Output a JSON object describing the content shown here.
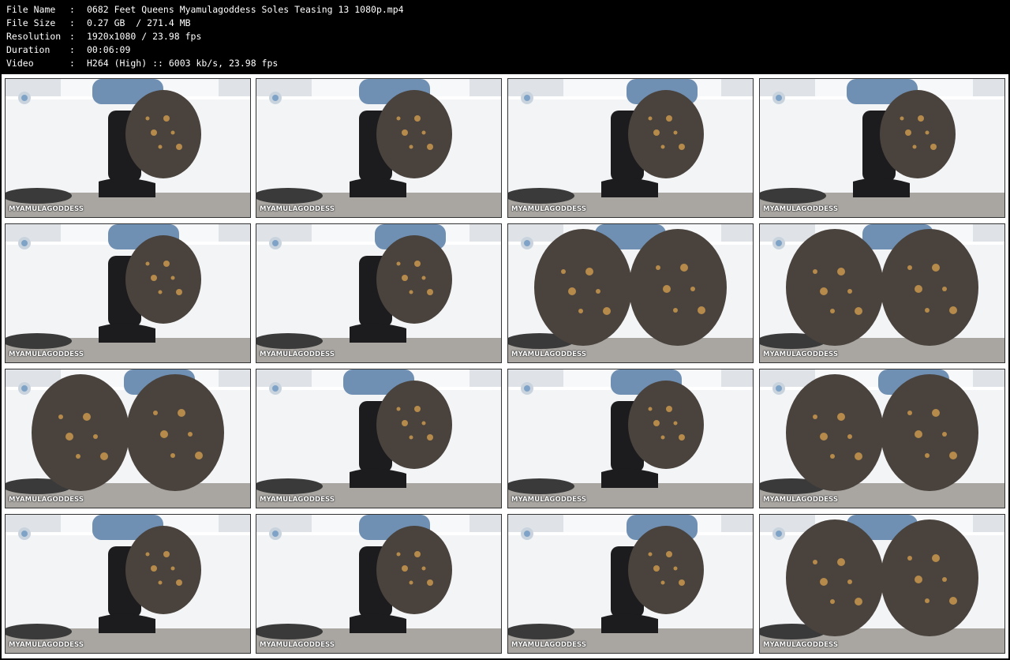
{
  "meta": {
    "rows": [
      {
        "key": "File Name",
        "sep": ":",
        "value": "0682 Feet Queens Myamulagoddess Soles Teasing 13 1080p.mp4"
      },
      {
        "key": "File Size",
        "sep": ":",
        "value": "0.27 GB  / 271.4 MB"
      },
      {
        "key": "Resolution",
        "sep": ":",
        "value": "1920x1080 / 23.98 fps"
      },
      {
        "key": "Duration",
        "sep": ":",
        "value": "00:06:09"
      },
      {
        "key": "Video",
        "sep": ":",
        "value": "H264 (High) :: 6003 kb/s, 23.98 fps"
      }
    ]
  },
  "thumbnails": {
    "watermark": "MYAMULAGODDESS",
    "count": 16,
    "colors": {
      "tub": "#f2f4f6",
      "wall": "#dfe3e8",
      "floor": "#a9a6a2",
      "boot": "#1c1b1d",
      "sole": "#4a433d",
      "dirt": "#b58a4a",
      "jeans": "#6f8fb3",
      "rug": "#3a3a3a"
    }
  }
}
